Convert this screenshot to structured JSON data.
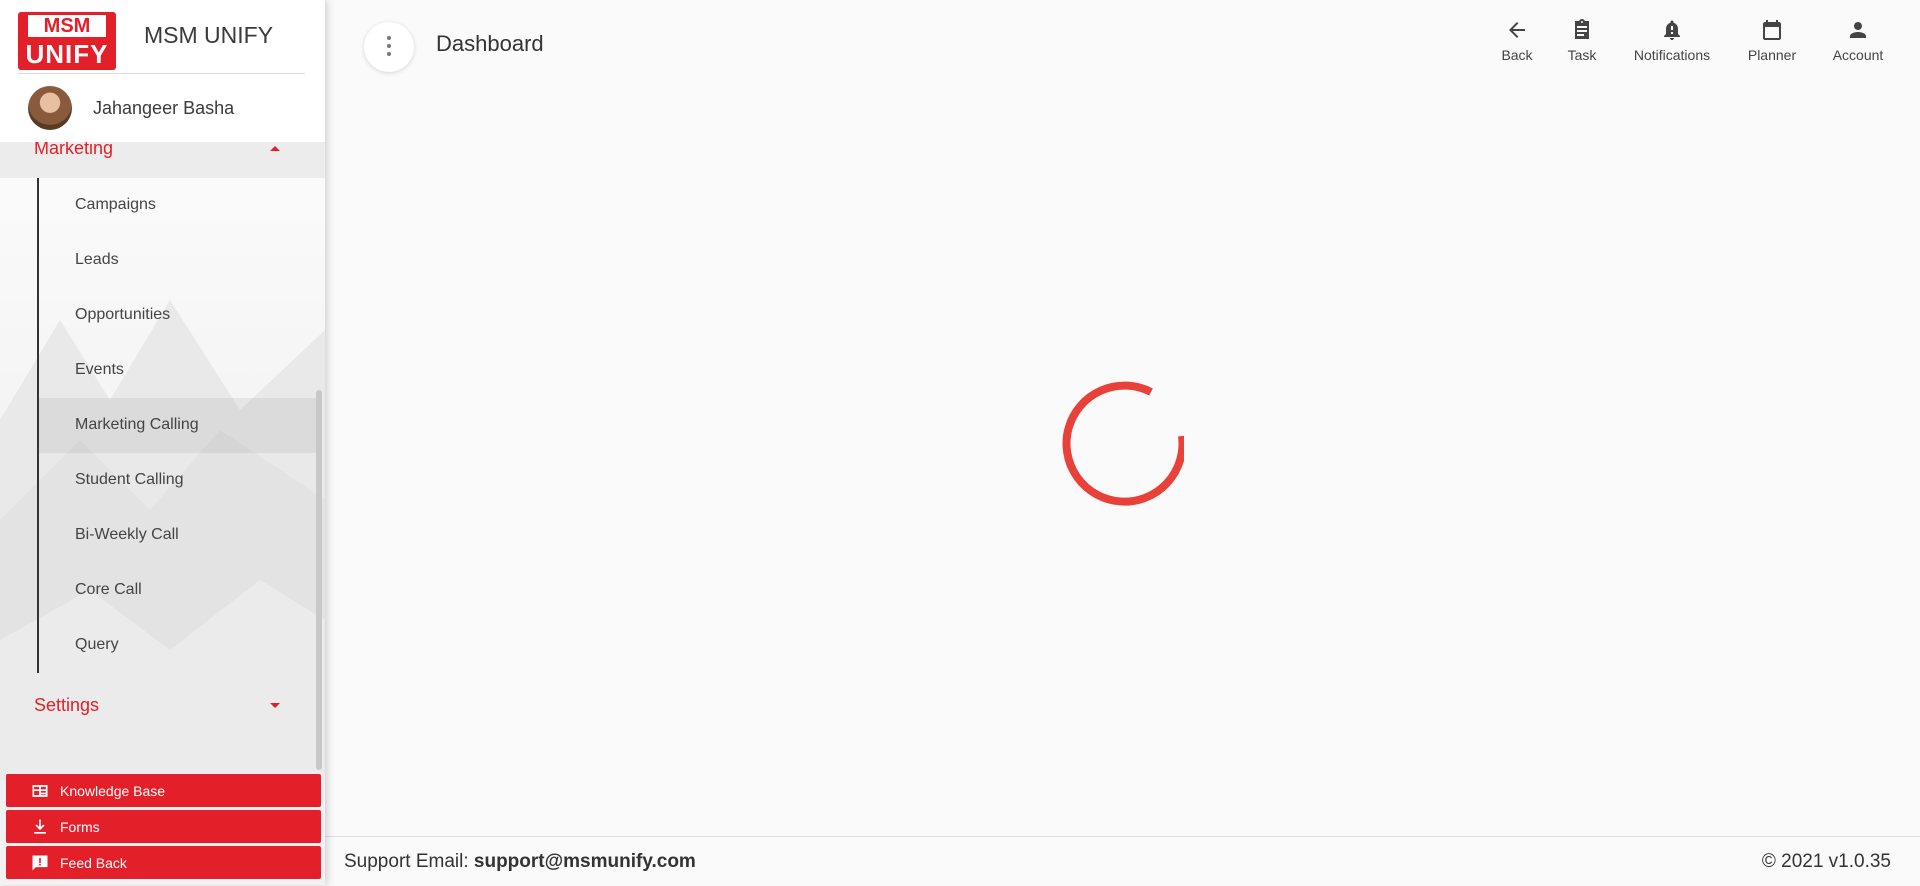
{
  "brand": {
    "logo_top": "MSM",
    "logo_bottom": "UNIFY",
    "name": "MSM UNIFY"
  },
  "user": {
    "name": "Jahangeer Basha"
  },
  "sidebar": {
    "section": "Marketing",
    "items": [
      {
        "label": "Campaigns"
      },
      {
        "label": "Leads"
      },
      {
        "label": "Opportunities"
      },
      {
        "label": "Events"
      },
      {
        "label": "Marketing Calling"
      },
      {
        "label": "Student Calling"
      },
      {
        "label": "Bi-Weekly Call"
      },
      {
        "label": "Core Call"
      },
      {
        "label": "Query"
      }
    ],
    "active_item": "Marketing Calling",
    "settings": "Settings",
    "buttons": [
      {
        "label": "Knowledge Base",
        "icon": "knowledge-base-icon"
      },
      {
        "label": "Forms",
        "icon": "download-icon"
      },
      {
        "label": "Feed Back",
        "icon": "feedback-icon"
      }
    ]
  },
  "header": {
    "title": "Dashboard",
    "nav": [
      {
        "label": "Back",
        "icon": "arrow-back-icon"
      },
      {
        "label": "Task",
        "icon": "clipboard-icon"
      },
      {
        "label": "Notifications",
        "icon": "bell-icon"
      },
      {
        "label": "Planner",
        "icon": "calendar-icon"
      },
      {
        "label": "Account",
        "icon": "person-icon"
      }
    ]
  },
  "footer": {
    "support_label": "Support Email:",
    "support_email": "support@msmunify.com",
    "version": "© 2021 v1.0.35"
  },
  "colors": {
    "accent": "#e3202a",
    "background": "#fafafa"
  }
}
